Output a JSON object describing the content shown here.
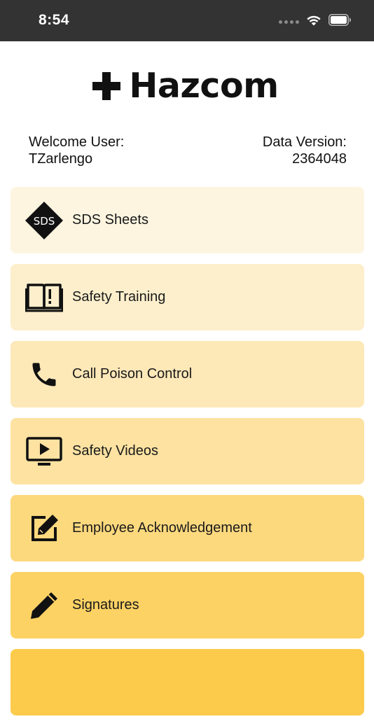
{
  "status_bar": {
    "time": "8:54"
  },
  "header": {
    "app_name": "Hazcom"
  },
  "info": {
    "welcome_label": "Welcome User:",
    "user_name": "TZarlengo",
    "data_version_label": "Data Version:",
    "data_version": "2364048"
  },
  "menu": {
    "items": [
      {
        "label": "SDS Sheets",
        "icon": "sds-diamond-icon",
        "icon_text": "SDS",
        "bg": "#fdf5e0"
      },
      {
        "label": "Safety Training",
        "icon": "book-alert-icon",
        "bg": "#fdefcc"
      },
      {
        "label": "Call Poison Control",
        "icon": "phone-icon",
        "bg": "#fde8b8"
      },
      {
        "label": "Safety Videos",
        "icon": "video-monitor-icon",
        "bg": "#fde2a2"
      },
      {
        "label": "Employee Acknowledgement",
        "icon": "edit-square-icon",
        "bg": "#fdd97e"
      },
      {
        "label": "Signatures",
        "icon": "pencil-icon",
        "bg": "#fdd264"
      },
      {
        "label": "",
        "icon": "",
        "bg": "#fdcb4c"
      }
    ]
  },
  "colors": {
    "status_bar_bg": "#333333",
    "text": "#111111"
  }
}
